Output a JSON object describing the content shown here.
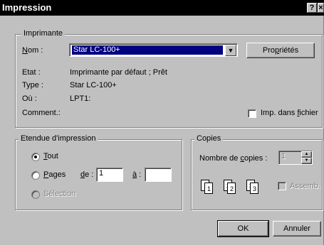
{
  "window": {
    "title": "Impression",
    "help_glyph": "?",
    "close_glyph": "×"
  },
  "printer": {
    "group_label": "Imprimante",
    "name_label": "Nom :",
    "name_value": "Star LC-100+",
    "properties_button": "Propriétés",
    "status_label": "Etat :",
    "status_value": "Imprimante par défaut ; Prêt",
    "type_label": "Type :",
    "type_value": "Star LC-100+",
    "where_label": "Où :",
    "where_value": "LPT1:",
    "comment_label": "Comment.:",
    "print_to_file_label": "Imp. dans fichier",
    "print_to_file_checked": false
  },
  "range": {
    "group_label": "Etendue d'impression",
    "all_label": "Tout",
    "all_selected": true,
    "pages_label": "Pages",
    "from_label": "de :",
    "from_value": "1",
    "to_label": "à :",
    "to_value": "",
    "selection_label": "Sélection"
  },
  "copies": {
    "group_label": "Copies",
    "count_label": "Nombre de copies :",
    "count_value": "1",
    "collate_label": "Assemb.",
    "collate_checked": false,
    "page_icons": [
      {
        "back": "1",
        "front": "1"
      },
      {
        "back": "2",
        "front": "2"
      },
      {
        "back": "3",
        "front": "3"
      }
    ]
  },
  "buttons": {
    "ok": "OK",
    "cancel": "Annuler"
  }
}
